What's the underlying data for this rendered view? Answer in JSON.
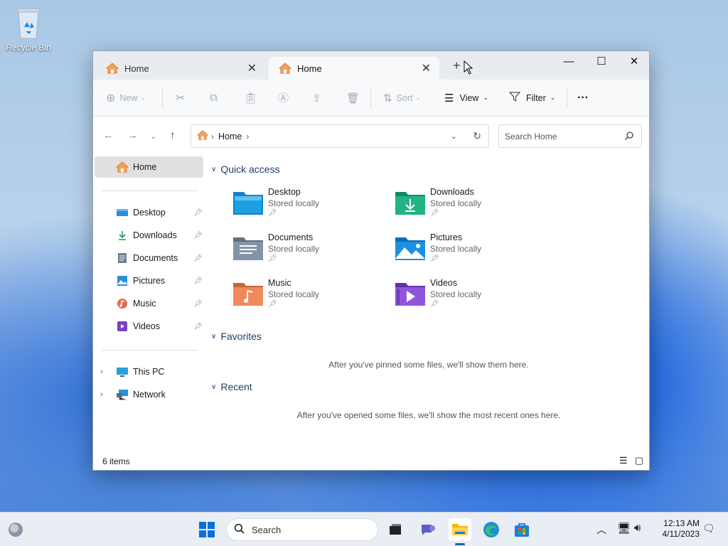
{
  "desktop": {
    "recycle_bin_label": "Recycle Bin"
  },
  "window": {
    "tabs": [
      {
        "label": "Home",
        "active": false
      },
      {
        "label": "Home",
        "active": true
      }
    ],
    "new_tab_label": "+",
    "controls": {
      "minimize": "—",
      "maximize": "☐",
      "close": "✕"
    }
  },
  "toolbar": {
    "new_label": "New",
    "sort_label": "Sort",
    "view_label": "View",
    "filter_label": "Filter",
    "more_label": "···"
  },
  "address": {
    "crumb": "Home",
    "search_placeholder": "Search Home"
  },
  "sidebar": {
    "home": "Home",
    "pinned": [
      {
        "label": "Desktop",
        "icon": "desktop-icon"
      },
      {
        "label": "Downloads",
        "icon": "downloads-icon"
      },
      {
        "label": "Documents",
        "icon": "documents-icon"
      },
      {
        "label": "Pictures",
        "icon": "pictures-icon"
      },
      {
        "label": "Music",
        "icon": "music-icon"
      },
      {
        "label": "Videos",
        "icon": "videos-icon"
      }
    ],
    "this_pc": "This PC",
    "network": "Network"
  },
  "main": {
    "quick_access_title": "Quick access",
    "quick_access": [
      {
        "name": "Desktop",
        "sub": "Stored locally"
      },
      {
        "name": "Downloads",
        "sub": "Stored locally"
      },
      {
        "name": "Documents",
        "sub": "Stored locally"
      },
      {
        "name": "Pictures",
        "sub": "Stored locally"
      },
      {
        "name": "Music",
        "sub": "Stored locally"
      },
      {
        "name": "Videos",
        "sub": "Stored locally"
      }
    ],
    "favorites_title": "Favorites",
    "favorites_empty": "After you've pinned some files, we'll show them here.",
    "recent_title": "Recent",
    "recent_empty": "After you've opened some files, we'll show the most recent ones here."
  },
  "status": {
    "count": "6 items"
  },
  "taskbar": {
    "search_label": "Search",
    "time": "12:13 AM",
    "date": "4/11/2023"
  },
  "colors": {
    "accent": "#0067c0",
    "title_text": "#1f3e6b"
  }
}
